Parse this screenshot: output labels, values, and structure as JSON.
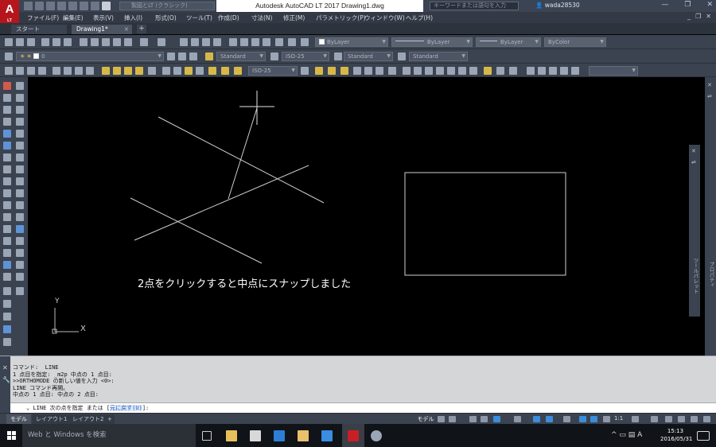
{
  "title_bar": {
    "app_logo_text": "A",
    "app_logo_sub": "LT",
    "workspace_selector": "製図とLT (クラシック)",
    "document_title": "Autodesk AutoCAD LT 2017    Drawing1.dwg",
    "search_placeholder": "キーワードまたは語句を入力",
    "username": "wada28530",
    "minimize_glyph": "—",
    "restore_glyph": "❐",
    "close_glyph": "✕"
  },
  "menu_bar": {
    "items": [
      "ファイル(F)",
      "編集(E)",
      "表示(V)",
      "挿入(I)",
      "形式(O)",
      "ツール(T)",
      "作成(D)",
      "寸法(N)",
      "修正(M)",
      "パラメトリック(P)",
      "ウィンドウ(W)",
      "ヘルプ(H)"
    ],
    "mdi_minimize": "_",
    "mdi_restore": "❐",
    "mdi_close": "✕"
  },
  "doc_tabs": {
    "start": "スタート",
    "active": "Drawing1*",
    "close_glyph": "×",
    "add_glyph": "+"
  },
  "properties_toolbar": {
    "color": "ByLayer",
    "linetype": "ByLayer",
    "lineweight": "ByLayer",
    "plotstyle": "ByColor"
  },
  "layer_toolbar": {
    "current_layer": "0",
    "text_style": "Standard",
    "dim_style": "ISO-25",
    "table_style": "Standard",
    "multileader_style": "Standard"
  },
  "dimension_toolbar": {
    "dim_style": "ISO-25"
  },
  "right_panels": {
    "properties_label": "プロパティ",
    "palette_label": "ツールパレット"
  },
  "canvas": {
    "annotation": "2点をクリックすると中点にスナップしました",
    "ucs_y": "Y",
    "ucs_x": "X"
  },
  "command_line": {
    "history": [
      "コマンド:  LINE",
      "1 点目を指定: _m2p 中点の 1 点目:",
      ">>ORTHOMODE の新しい値を入力 <0>:",
      "LINE コマンド再開。",
      "中点の 1 点目: 中点の 2 点目:"
    ],
    "prompt_prefix": "⌄ LINE 次の点を指定 または [",
    "prompt_option": "元に戻す(U)",
    "prompt_suffix": "]:"
  },
  "layout_tabs": [
    "モデル",
    "レイアウト1",
    "レイアウト2"
  ],
  "layout_tab_add": "+",
  "status_bar": {
    "model_label": "モデル",
    "annotation_scale": "1:1"
  },
  "taskbar": {
    "search_placeholder": "Web と Windows を検索",
    "ime_indicator": "A",
    "time": "15:13",
    "date": "2016/05/31"
  }
}
